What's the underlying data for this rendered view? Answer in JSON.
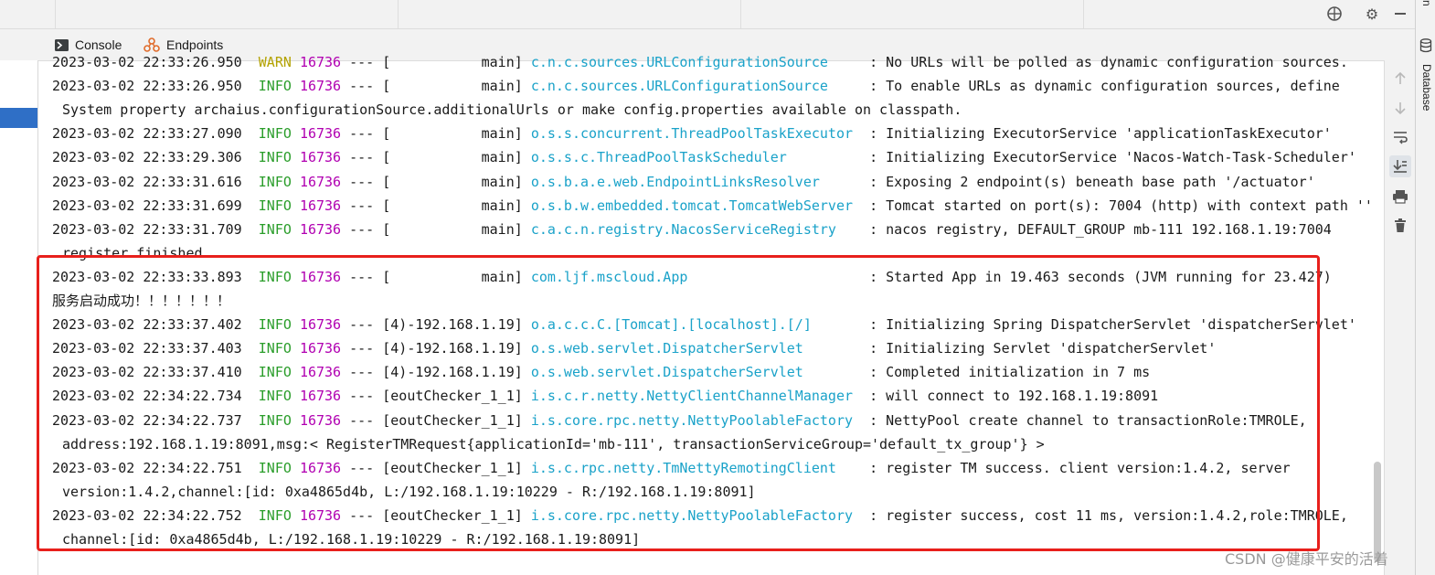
{
  "tabs": [
    {
      "label": "Console",
      "icon": "console-icon"
    },
    {
      "label": "Endpoints",
      "icon": "endpoints-icon"
    }
  ],
  "top_icons": [
    "crosshair-icon",
    "gear-icon",
    "minimize-icon"
  ],
  "right_actions": [
    "scroll-up-icon",
    "scroll-down-icon",
    "soft-wrap-icon",
    "scroll-to-end-icon",
    "print-icon",
    "trash-icon"
  ],
  "side_tools": {
    "database_label": "Database",
    "top_label": "n"
  },
  "colors": {
    "info": "#2a9d2a",
    "warn": "#b3a200",
    "pid": "#b100b1",
    "logger": "#1aa2c9",
    "highlight": "#e8201c"
  },
  "log": {
    "lines": [
      {
        "ts": "2023-03-02 22:33:26.950",
        "level": "WARN",
        "pid": "16736",
        "sep": "---",
        "thread": "[           main]",
        "logger": "c.n.c.sources.URLConfigurationSource    ",
        "msg": ": No URLs will be polled as dynamic configuration sources."
      },
      {
        "ts": "2023-03-02 22:33:26.950",
        "level": "INFO",
        "pid": "16736",
        "sep": "---",
        "thread": "[           main]",
        "logger": "c.n.c.sources.URLConfigurationSource    ",
        "msg": ": To enable URLs as dynamic configuration sources, define"
      },
      {
        "text": "System property archaius.configurationSource.additionalUrls or make config.properties available on classpath."
      },
      {
        "ts": "2023-03-02 22:33:27.090",
        "level": "INFO",
        "pid": "16736",
        "sep": "---",
        "thread": "[           main]",
        "logger": "o.s.s.concurrent.ThreadPoolTaskExecutor ",
        "msg": ": Initializing ExecutorService 'applicationTaskExecutor'"
      },
      {
        "ts": "2023-03-02 22:33:29.306",
        "level": "INFO",
        "pid": "16736",
        "sep": "---",
        "thread": "[           main]",
        "logger": "o.s.s.c.ThreadPoolTaskScheduler         ",
        "msg": ": Initializing ExecutorService 'Nacos-Watch-Task-Scheduler'"
      },
      {
        "ts": "2023-03-02 22:33:31.616",
        "level": "INFO",
        "pid": "16736",
        "sep": "---",
        "thread": "[           main]",
        "logger": "o.s.b.a.e.web.EndpointLinksResolver     ",
        "msg": ": Exposing 2 endpoint(s) beneath base path '/actuator'"
      },
      {
        "ts": "2023-03-02 22:33:31.699",
        "level": "INFO",
        "pid": "16736",
        "sep": "---",
        "thread": "[           main]",
        "logger": "o.s.b.w.embedded.tomcat.TomcatWebServer ",
        "msg": ": Tomcat started on port(s): 7004 (http) with context path ''"
      },
      {
        "ts": "2023-03-02 22:33:31.709",
        "level": "INFO",
        "pid": "16736",
        "sep": "---",
        "thread": "[           main]",
        "logger": "c.a.c.n.registry.NacosServiceRegistry   ",
        "msg": ": nacos registry, DEFAULT_GROUP mb-111 192.168.1.19:7004"
      },
      {
        "text": "register finished"
      },
      {
        "ts": "2023-03-02 22:33:33.893",
        "level": "INFO",
        "pid": "16736",
        "sep": "---",
        "thread": "[           main]",
        "logger": "com.ljf.mscloud.App                     ",
        "msg": ": Started App in 19.463 seconds (JVM running for 23.427)"
      },
      {
        "text": "服务启动成功！！！！！！！",
        "flush": true
      },
      {
        "ts": "2023-03-02 22:33:37.402",
        "level": "INFO",
        "pid": "16736",
        "sep": "---",
        "thread": "[4)-192.168.1.19]",
        "logger": "o.a.c.c.C.[Tomcat].[localhost].[/]      ",
        "msg": ": Initializing Spring DispatcherServlet 'dispatcherServlet'"
      },
      {
        "ts": "2023-03-02 22:33:37.403",
        "level": "INFO",
        "pid": "16736",
        "sep": "---",
        "thread": "[4)-192.168.1.19]",
        "logger": "o.s.web.servlet.DispatcherServlet       ",
        "msg": ": Initializing Servlet 'dispatcherServlet'"
      },
      {
        "ts": "2023-03-02 22:33:37.410",
        "level": "INFO",
        "pid": "16736",
        "sep": "---",
        "thread": "[4)-192.168.1.19]",
        "logger": "o.s.web.servlet.DispatcherServlet       ",
        "msg": ": Completed initialization in 7 ms"
      },
      {
        "ts": "2023-03-02 22:34:22.734",
        "level": "INFO",
        "pid": "16736",
        "sep": "---",
        "thread": "[eoutChecker_1_1]",
        "logger": "i.s.c.r.netty.NettyClientChannelManager ",
        "msg": ": will connect to 192.168.1.19:8091"
      },
      {
        "ts": "2023-03-02 22:34:22.737",
        "level": "INFO",
        "pid": "16736",
        "sep": "---",
        "thread": "[eoutChecker_1_1]",
        "logger": "i.s.core.rpc.netty.NettyPoolableFactory ",
        "msg": ": NettyPool create channel to transactionRole:TMROLE,"
      },
      {
        "text": "address:192.168.1.19:8091,msg:< RegisterTMRequest{applicationId='mb-111', transactionServiceGroup='default_tx_group'} >"
      },
      {
        "ts": "2023-03-02 22:34:22.751",
        "level": "INFO",
        "pid": "16736",
        "sep": "---",
        "thread": "[eoutChecker_1_1]",
        "logger": "i.s.c.rpc.netty.TmNettyRemotingClient   ",
        "msg": ": register TM success. client version:1.4.2, server"
      },
      {
        "text": "version:1.4.2,channel:[id: 0xa4865d4b, L:/192.168.1.19:10229 - R:/192.168.1.19:8091]"
      },
      {
        "ts": "2023-03-02 22:34:22.752",
        "level": "INFO",
        "pid": "16736",
        "sep": "---",
        "thread": "[eoutChecker_1_1]",
        "logger": "i.s.core.rpc.netty.NettyPoolableFactory ",
        "msg": ": register success, cost 11 ms, version:1.4.2,role:TMROLE,"
      },
      {
        "text": "channel:[id: 0xa4865d4b, L:/192.168.1.19:10229 - R:/192.168.1.19:8091]"
      }
    ]
  },
  "watermark": "CSDN @健康平安的活着"
}
